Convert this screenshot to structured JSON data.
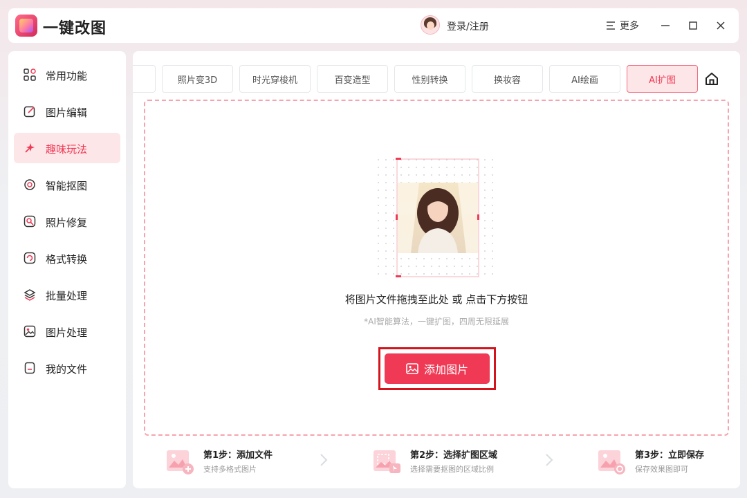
{
  "app": {
    "title": "一键改图"
  },
  "header": {
    "login_label": "登录/注册",
    "more_label": "更多",
    "controls": [
      "minimize",
      "maximize",
      "close"
    ]
  },
  "sidebar": {
    "items": [
      {
        "label": "常用功能",
        "icon": "grid-icon"
      },
      {
        "label": "图片编辑",
        "icon": "edit-icon"
      },
      {
        "label": "趣味玩法",
        "icon": "sparkle-icon",
        "active": true
      },
      {
        "label": "智能抠图",
        "icon": "target-icon"
      },
      {
        "label": "照片修复",
        "icon": "repair-icon"
      },
      {
        "label": "格式转换",
        "icon": "convert-icon"
      },
      {
        "label": "批量处理",
        "icon": "layers-icon"
      },
      {
        "label": "图片处理",
        "icon": "image-icon"
      },
      {
        "label": "我的文件",
        "icon": "file-icon"
      }
    ]
  },
  "tabs": [
    {
      "label": "照片变3D"
    },
    {
      "label": "时光穿梭机"
    },
    {
      "label": "百变造型"
    },
    {
      "label": "性别转换"
    },
    {
      "label": "换妆容"
    },
    {
      "label": "AI绘画"
    },
    {
      "label": "AI扩图",
      "active": true
    }
  ],
  "dropzone": {
    "prompt": "将图片文件拖拽至此处 或 点击下方按钮",
    "subtext": "*AI智能算法，一键扩图，四周无限延展",
    "button_label": "添加图片"
  },
  "steps": [
    {
      "title": "第1步：添加文件",
      "desc": "支持多格式图片"
    },
    {
      "title": "第2步：选择扩图区域",
      "desc": "选择需要抠图的区域比例"
    },
    {
      "title": "第3步：立即保存",
      "desc": "保存效果图即可"
    }
  ],
  "colors": {
    "accent": "#f03a55",
    "active_bg": "#fde6e8",
    "highlight_outline": "#d4141d"
  }
}
